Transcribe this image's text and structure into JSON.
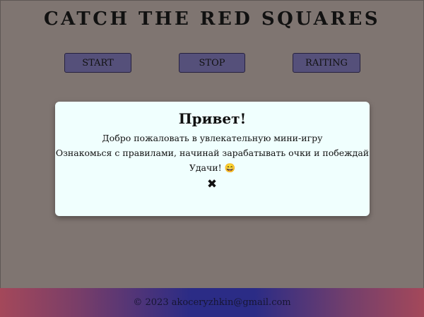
{
  "header": {
    "title": "CATCH THE RED SQUARES"
  },
  "controls": {
    "start_label": "START",
    "stop_label": "STOP",
    "rating_label": "RAITING"
  },
  "modal": {
    "title": "Привет!",
    "line1": "Добро пожаловать в увлекательную мини-игру",
    "line2": "Ознакомься с правилами, начинай зарабатывать очки и побеждай",
    "line3": "Удачи! 😄",
    "close_icon": "✖"
  },
  "footer": {
    "text": "© 2023 akoceryzhkin@gmail.com"
  },
  "colors": {
    "background": "#7f7571",
    "button": "#55507a",
    "modal": "#f0fffe",
    "footer_center": "#2b2c86",
    "footer_edge": "#a4485a"
  }
}
